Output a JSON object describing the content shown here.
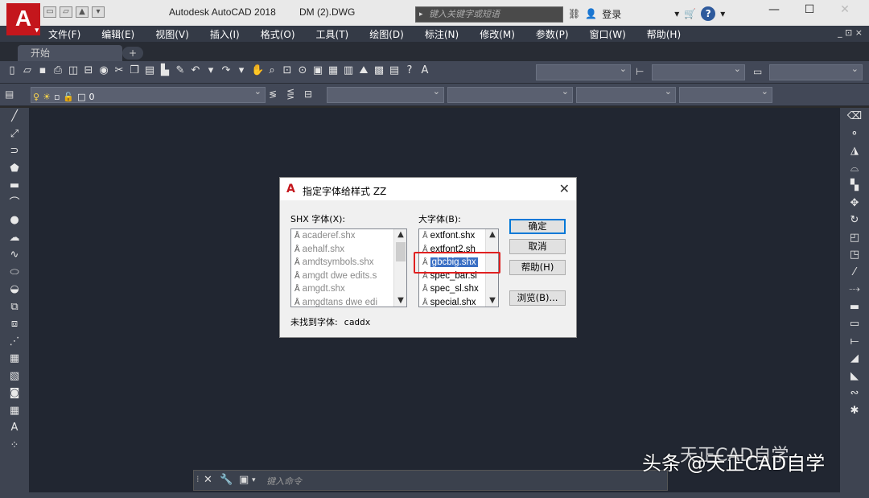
{
  "titlebar": {
    "app_logo": "A",
    "app_title": "Autodesk AutoCAD 2018",
    "doc_title": "DM (2).DWG",
    "search_placeholder": "键入关键字或短语",
    "login": "登录",
    "help": "?",
    "window_controls": [
      "—",
      "☐",
      "✕"
    ]
  },
  "menu": {
    "items": [
      "文件(F)",
      "编辑(E)",
      "视图(V)",
      "插入(I)",
      "格式(O)",
      "工具(T)",
      "绘图(D)",
      "标注(N)",
      "修改(M)",
      "参数(P)",
      "窗口(W)",
      "帮助(H)"
    ],
    "mdi_controls": "_ ⊡ ×"
  },
  "tabs": {
    "start": "开始",
    "add": "+"
  },
  "layer": {
    "current": "0"
  },
  "command": {
    "placeholder": "键入命令"
  },
  "dialog": {
    "title": "指定字体给样式 ZZ",
    "shx_label": "SHX 字体(X):",
    "bigfont_label": "大字体(B):",
    "shx_fonts": [
      "acaderef.shx",
      "aehalf.shx",
      "amdtsymbols.shx",
      "amgdt dwe edits.s",
      "amgdt.shx",
      "amgdtans dwe edi"
    ],
    "big_fonts": [
      "extfont.shx",
      "extfont2.sh",
      "gbcbig.shx",
      "spec_bar.sl",
      "spec_sl.shx",
      "special.shx"
    ],
    "selected_big_font": "gbcbig.shx",
    "missing_label": "未找到字体:",
    "missing_font": "caddx",
    "buttons": {
      "ok": "确定",
      "cancel": "取消",
      "help": "帮助(H)",
      "browse": "浏览(B)..."
    }
  },
  "watermark": {
    "text1": "天正CAD自学",
    "text2": "头条 @天正CAD自学"
  },
  "colors": {
    "accent": "#c4161c",
    "selection": "#3a6fc4",
    "highlight_box": "#e02020",
    "canvas": "#212631"
  }
}
